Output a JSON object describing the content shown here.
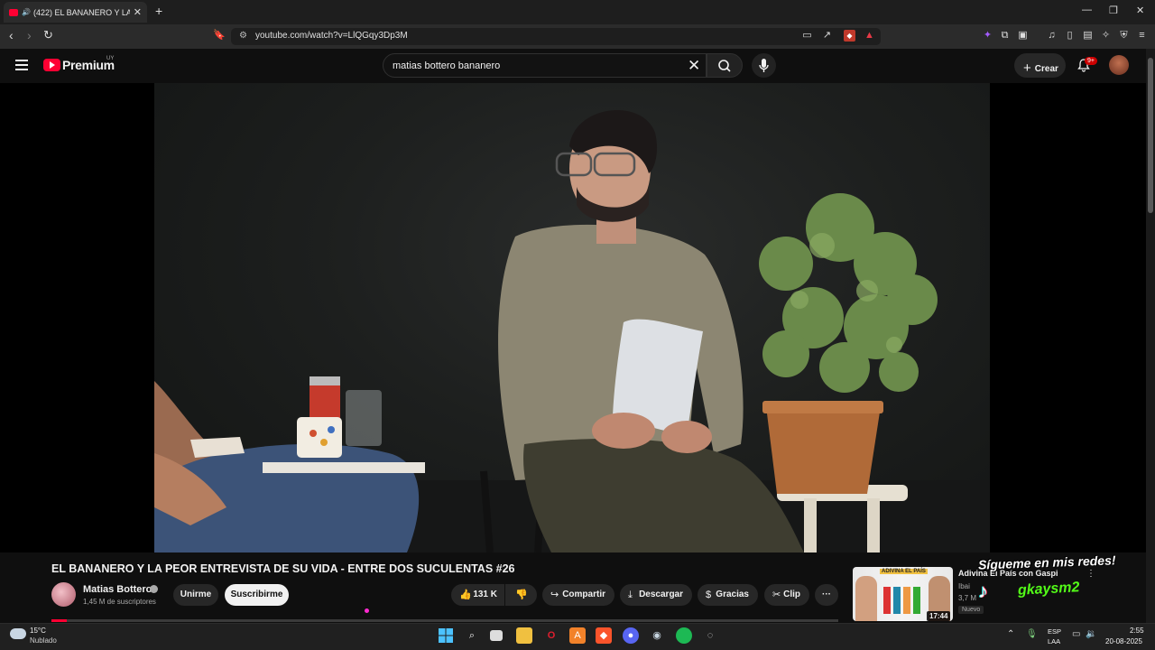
{
  "browser": {
    "tab_title": "(422) EL BANANERO Y LA PE",
    "url": "youtube.com/watch?v=LlQGqy3Dp3M"
  },
  "youtube": {
    "brand": "Premium",
    "country": "UY",
    "search_value": "matias bottero bananero",
    "create_label": "Crear",
    "notifications": "9+"
  },
  "video": {
    "title": "EL BANANERO Y LA PEOR ENTREVISTA DE SU VIDA - ENTRE DOS SUCULENTAS #26",
    "channel_name": "Matias Bottero",
    "subscribers": "1,45 M de suscriptores",
    "join_label": "Unirme",
    "subscribe_label": "Suscribirme",
    "likes": "131 K",
    "share_label": "Compartir",
    "download_label": "Descargar",
    "thanks_label": "Gracias",
    "clip_label": "Clip",
    "more_label": "···",
    "progress_fraction": 0.02
  },
  "recommendation": {
    "title": "Adivina El País con Gaspi",
    "channel": "Ibai",
    "views": "3,7 M",
    "duration": "17:44",
    "badge": "Nuevo",
    "thumb_text": "ADIVINA EL PAÍS"
  },
  "overlay": {
    "follow_text": "Sígueme en mis redes!",
    "kick_handle": "gkaysm2"
  },
  "taskbar": {
    "temperature": "15°C",
    "condition": "Nublado",
    "lang_top": "ESP",
    "lang_bottom": "LAA",
    "time": "2:55",
    "date": "20-08-2025"
  },
  "colors": {
    "yt_red": "#ff0033",
    "background": "#0f0f0f",
    "pill": "#272727"
  }
}
